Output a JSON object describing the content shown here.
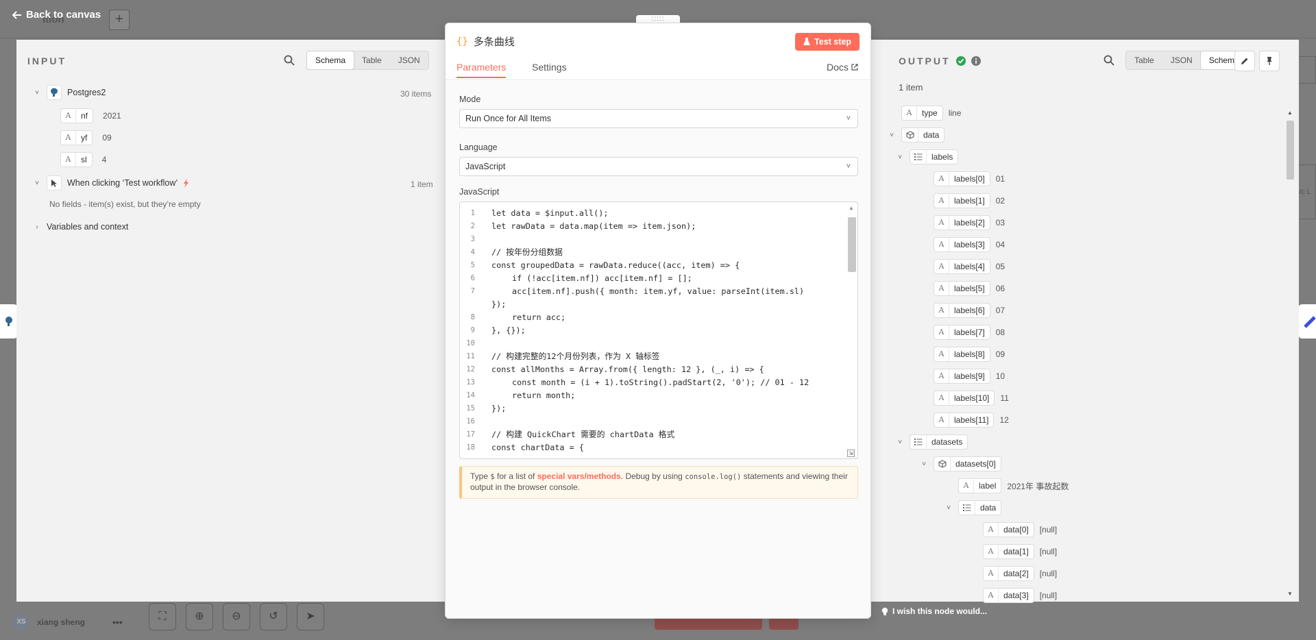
{
  "canvas": {
    "back_label": "Back to canvas",
    "workflow_name": "ition",
    "user_name": "xiang sheng",
    "user_initials": "XS",
    "add_symbol": "+",
    "more_symbol": "•••",
    "right_edge_text": "sic L"
  },
  "input": {
    "title": "INPUT",
    "view_tabs": [
      "Schema",
      "Table",
      "JSON"
    ],
    "active_tab": "Schema",
    "nodes": [
      {
        "name": "Postgres2",
        "count": "30 items",
        "fields": [
          {
            "key": "nf",
            "value": "2021"
          },
          {
            "key": "yf",
            "value": "09"
          },
          {
            "key": "sl",
            "value": "4"
          }
        ]
      },
      {
        "name": "When clicking ‘Test workflow’",
        "count": "1 item",
        "empty_text": "No fields - item(s) exist, but they’re empty"
      }
    ],
    "variables_label": "Variables and context"
  },
  "editor": {
    "title_icon": "{}",
    "title": "多条曲线",
    "test_step_label": "Test step",
    "tabs": [
      "Parameters",
      "Settings"
    ],
    "active_tab": "Parameters",
    "docs_label": "Docs",
    "mode_label": "Mode",
    "mode_value": "Run Once for All Items",
    "language_label": "Language",
    "language_value": "JavaScript",
    "code_label": "JavaScript",
    "code_lines": [
      {
        "n": "1",
        "text": "let data = $input.all();",
        "indent": false
      },
      {
        "n": "2",
        "text": "let rawData = data.map(item => item.json);",
        "indent": false
      },
      {
        "n": "3",
        "text": "",
        "indent": false
      },
      {
        "n": "4",
        "text": "// 按年份分组数据",
        "indent": false
      },
      {
        "n": "5",
        "text": "const groupedData = rawData.reduce((acc, item) => {",
        "indent": false
      },
      {
        "n": "6",
        "text": "if (!acc[item.nf]) acc[item.nf] = [];",
        "indent": true
      },
      {
        "n": "7",
        "text": "acc[item.nf].push({ month: item.yf, value: parseInt(item.sl)",
        "indent": true
      },
      {
        "n": "",
        "text": "});",
        "indent": false
      },
      {
        "n": "8",
        "text": "return acc;",
        "indent": true
      },
      {
        "n": "9",
        "text": "}, {});",
        "indent": false
      },
      {
        "n": "10",
        "text": "",
        "indent": false
      },
      {
        "n": "11",
        "text": "// 构建完整的12个月份列表，作为 X 轴标签",
        "indent": false
      },
      {
        "n": "12",
        "text": "const allMonths = Array.from({ length: 12 }, (_, i) => {",
        "indent": false
      },
      {
        "n": "13",
        "text": "const month = (i + 1).toString().padStart(2, '0'); // 01 - 12",
        "indent": true
      },
      {
        "n": "14",
        "text": "return month;",
        "indent": true
      },
      {
        "n": "15",
        "text": "});",
        "indent": false
      },
      {
        "n": "16",
        "text": "",
        "indent": false
      },
      {
        "n": "17",
        "text": "// 构建 QuickChart 需要的 chartData 格式",
        "indent": false
      },
      {
        "n": "18",
        "text": "const chartData = {",
        "indent": false
      }
    ],
    "hint": {
      "prefix": "Type",
      "dollar": "$",
      "for_list": "for a list of",
      "link": "special vars/methods",
      "debug": ". Debug by using",
      "code": "console.log()",
      "suffix": "statements and viewing their output in the browser console."
    }
  },
  "output": {
    "title": "OUTPUT",
    "view_tabs": [
      "Table",
      "JSON",
      "Schema"
    ],
    "active_tab": "Schema",
    "item_count": "1 item",
    "rows": [
      {
        "key": "type",
        "value": "line",
        "kind": "string",
        "depth": 0
      },
      {
        "key": "data",
        "value": "",
        "kind": "object",
        "depth": 0,
        "caret": true
      },
      {
        "key": "labels",
        "value": "",
        "kind": "array",
        "depth": 1,
        "caret": true
      },
      {
        "key": "labels[0]",
        "value": "01",
        "kind": "string",
        "depth": 2
      },
      {
        "key": "labels[1]",
        "value": "02",
        "kind": "string",
        "depth": 2
      },
      {
        "key": "labels[2]",
        "value": "03",
        "kind": "string",
        "depth": 2
      },
      {
        "key": "labels[3]",
        "value": "04",
        "kind": "string",
        "depth": 2
      },
      {
        "key": "labels[4]",
        "value": "05",
        "kind": "string",
        "depth": 2
      },
      {
        "key": "labels[5]",
        "value": "06",
        "kind": "string",
        "depth": 2
      },
      {
        "key": "labels[6]",
        "value": "07",
        "kind": "string",
        "depth": 2
      },
      {
        "key": "labels[7]",
        "value": "08",
        "kind": "string",
        "depth": 2
      },
      {
        "key": "labels[8]",
        "value": "09",
        "kind": "string",
        "depth": 2
      },
      {
        "key": "labels[9]",
        "value": "10",
        "kind": "string",
        "depth": 2
      },
      {
        "key": "labels[10]",
        "value": "11",
        "kind": "string",
        "depth": 2
      },
      {
        "key": "labels[11]",
        "value": "12",
        "kind": "string",
        "depth": 2
      },
      {
        "key": "datasets",
        "value": "",
        "kind": "array",
        "depth": 1,
        "caret": true
      },
      {
        "key": "datasets[0]",
        "value": "",
        "kind": "object",
        "depth": 2,
        "caret": true
      },
      {
        "key": "label",
        "value": "2021年 事故起数",
        "kind": "string",
        "depth": 3
      },
      {
        "key": "data",
        "value": "",
        "kind": "array",
        "depth": 3,
        "caret": true
      },
      {
        "key": "data[0]",
        "value": "[null]",
        "kind": "string",
        "depth": 4
      },
      {
        "key": "data[1]",
        "value": "[null]",
        "kind": "string",
        "depth": 4
      },
      {
        "key": "data[2]",
        "value": "[null]",
        "kind": "string",
        "depth": 4
      },
      {
        "key": "data[3]",
        "value": "[null]",
        "kind": "string",
        "depth": 4
      }
    ],
    "wish_label": "I wish this node would..."
  },
  "colors": {
    "accent": "#ff6d5a",
    "success": "#2ea44f",
    "overlay": "#7d7d7d"
  }
}
